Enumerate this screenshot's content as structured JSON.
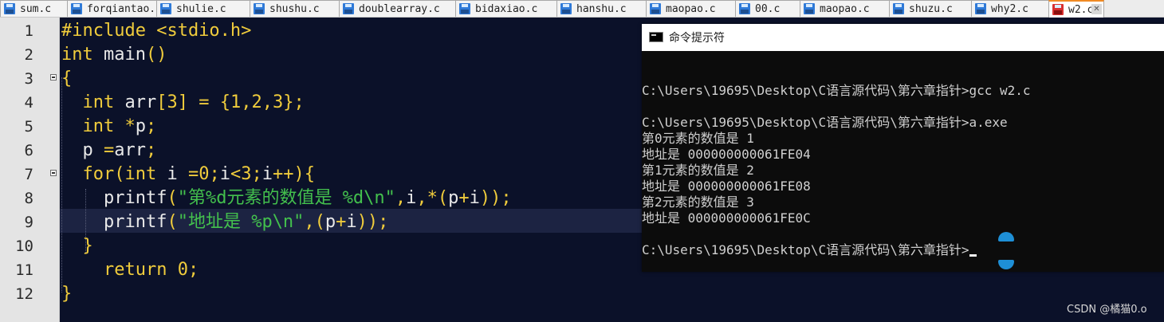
{
  "tabs": [
    {
      "label": "sum.c",
      "active": false
    },
    {
      "label": "forqiantao.c",
      "active": false
    },
    {
      "label": "shulie.c",
      "active": false
    },
    {
      "label": "shushu.c",
      "active": false
    },
    {
      "label": "doublearray.c",
      "active": false
    },
    {
      "label": "bidaxiao.c",
      "active": false
    },
    {
      "label": "hanshu.c",
      "active": false
    },
    {
      "label": "maopao.c",
      "active": false
    },
    {
      "label": "00.c",
      "active": false
    },
    {
      "label": "maopao.c",
      "active": false
    },
    {
      "label": "shuzu.c",
      "active": false
    },
    {
      "label": "why2.c",
      "active": false
    },
    {
      "label": "w2.c",
      "active": true
    }
  ],
  "editor": {
    "line_numbers": [
      "1",
      "2",
      "3",
      "4",
      "5",
      "6",
      "7",
      "8",
      "9",
      "10",
      "11",
      "12"
    ],
    "current_line": 9,
    "lines": [
      [
        {
          "t": "#include <stdio.h>",
          "c": "pp"
        }
      ],
      [
        {
          "t": "int",
          "c": "kw"
        },
        {
          "t": " main",
          "c": "tx"
        },
        {
          "t": "()",
          "c": "op"
        }
      ],
      [
        {
          "t": "{",
          "c": "op"
        }
      ],
      [
        {
          "t": "  ",
          "c": "tx"
        },
        {
          "t": "int",
          "c": "kw"
        },
        {
          "t": " arr",
          "c": "tx"
        },
        {
          "t": "[",
          "c": "op"
        },
        {
          "t": "3",
          "c": "op"
        },
        {
          "t": "] = {",
          "c": "op"
        },
        {
          "t": "1",
          "c": "op"
        },
        {
          "t": ",",
          "c": "op"
        },
        {
          "t": "2",
          "c": "op"
        },
        {
          "t": ",",
          "c": "op"
        },
        {
          "t": "3",
          "c": "op"
        },
        {
          "t": "};",
          "c": "op"
        }
      ],
      [
        {
          "t": "  ",
          "c": "tx"
        },
        {
          "t": "int",
          "c": "kw"
        },
        {
          "t": " ",
          "c": "tx"
        },
        {
          "t": "*",
          "c": "op"
        },
        {
          "t": "p",
          "c": "tx"
        },
        {
          "t": ";",
          "c": "op"
        }
      ],
      [
        {
          "t": "  p ",
          "c": "tx"
        },
        {
          "t": "=",
          "c": "op"
        },
        {
          "t": "arr",
          "c": "tx"
        },
        {
          "t": ";",
          "c": "op"
        }
      ],
      [
        {
          "t": "  ",
          "c": "tx"
        },
        {
          "t": "for",
          "c": "kw"
        },
        {
          "t": "(",
          "c": "op"
        },
        {
          "t": "int",
          "c": "kw"
        },
        {
          "t": " i ",
          "c": "tx"
        },
        {
          "t": "=",
          "c": "op"
        },
        {
          "t": "0",
          "c": "op"
        },
        {
          "t": ";",
          "c": "op"
        },
        {
          "t": "i",
          "c": "tx"
        },
        {
          "t": "<",
          "c": "op"
        },
        {
          "t": "3",
          "c": "op"
        },
        {
          "t": ";",
          "c": "op"
        },
        {
          "t": "i",
          "c": "tx"
        },
        {
          "t": "++){",
          "c": "op"
        }
      ],
      [
        {
          "t": "    printf",
          "c": "tx"
        },
        {
          "t": "(",
          "c": "op"
        },
        {
          "t": "\"第%d元素的数值是 %d\\n\"",
          "c": "str"
        },
        {
          "t": ",",
          "c": "op"
        },
        {
          "t": "i",
          "c": "tx"
        },
        {
          "t": ",*(",
          "c": "op"
        },
        {
          "t": "p",
          "c": "tx"
        },
        {
          "t": "+",
          "c": "op"
        },
        {
          "t": "i",
          "c": "tx"
        },
        {
          "t": "));",
          "c": "op"
        }
      ],
      [
        {
          "t": "    printf",
          "c": "tx"
        },
        {
          "t": "(",
          "c": "op"
        },
        {
          "t": "\"地址是 %p\\n\"",
          "c": "str"
        },
        {
          "t": ",(",
          "c": "op"
        },
        {
          "t": "p",
          "c": "tx"
        },
        {
          "t": "+",
          "c": "op"
        },
        {
          "t": "i",
          "c": "tx"
        },
        {
          "t": "));",
          "c": "op"
        }
      ],
      [
        {
          "t": "  ",
          "c": "tx"
        },
        {
          "t": "}",
          "c": "op"
        }
      ],
      [
        {
          "t": "    ",
          "c": "tx"
        },
        {
          "t": "return",
          "c": "kw"
        },
        {
          "t": " ",
          "c": "tx"
        },
        {
          "t": "0",
          "c": "op"
        },
        {
          "t": ";",
          "c": "op"
        }
      ],
      [
        {
          "t": "}",
          "c": "op"
        }
      ]
    ]
  },
  "cmd": {
    "title": "命令提示符",
    "lines": [
      "",
      "",
      "C:\\Users\\19695\\Desktop\\C语言源代码\\第六章指针>gcc w2.c",
      "",
      "C:\\Users\\19695\\Desktop\\C语言源代码\\第六章指针>a.exe",
      "第0元素的数值是 1",
      "地址是 000000000061FE04",
      "第1元素的数值是 2",
      "地址是 000000000061FE08",
      "第2元素的数值是 3",
      "地址是 000000000061FE0C",
      "",
      "C:\\Users\\19695\\Desktop\\C语言源代码\\第六章指针>"
    ]
  },
  "watermark": "CSDN @橘猫0.o",
  "colors": {
    "editor_bg": "#0b1129",
    "keyword": "#f0cc3c",
    "string": "#43c04d",
    "text": "#e9e9e9",
    "active_tab_accent": "#f08a24"
  }
}
